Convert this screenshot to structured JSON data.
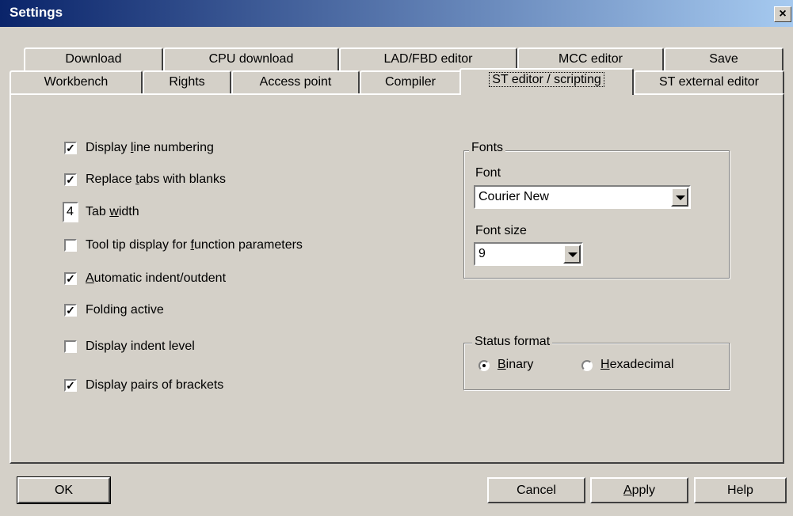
{
  "window": {
    "title": "Settings"
  },
  "tabs_row_top": [
    "Download",
    "CPU download",
    "LAD/FBD editor",
    "MCC editor",
    "Save"
  ],
  "tabs_row_bottom": [
    "Workbench",
    "Rights",
    "Access point",
    "Compiler",
    "ST editor / scripting",
    "ST external editor"
  ],
  "options": {
    "line_numbering": {
      "checked": true,
      "label_pre": "Display ",
      "label_u": "l",
      "label_post": "ine numbering"
    },
    "replace_tabs": {
      "checked": true,
      "label_pre": "Replace ",
      "label_u": "t",
      "label_post": "abs with blanks"
    },
    "tab_width": {
      "value": "4",
      "label_pre": "Tab ",
      "label_u": "w",
      "label_post": "idth"
    },
    "tooltip": {
      "checked": false,
      "label_pre": "Tool tip display for ",
      "label_u": "f",
      "label_post": "unction parameters"
    },
    "auto_indent": {
      "checked": true,
      "label_pre": "",
      "label_u": "A",
      "label_post": "utomatic indent/outdent"
    },
    "folding": {
      "checked": true,
      "label": "Folding active"
    },
    "indent_level": {
      "checked": false,
      "label": "Display indent level"
    },
    "brackets": {
      "checked": true,
      "label": "Display pairs of brackets"
    }
  },
  "fonts_group": {
    "legend": "Fonts",
    "font_label": "Font",
    "font_value": "Courier New",
    "size_label": "Font size",
    "size_value": "9"
  },
  "status_group": {
    "legend": "Status format",
    "binary_u": "B",
    "binary_rest": "inary",
    "hex_u": "H",
    "hex_rest": "exadecimal",
    "selected": "Binary"
  },
  "buttons": {
    "ok": "OK",
    "cancel": "Cancel",
    "apply_u": "A",
    "apply_rest": "pply",
    "help": "Help"
  }
}
